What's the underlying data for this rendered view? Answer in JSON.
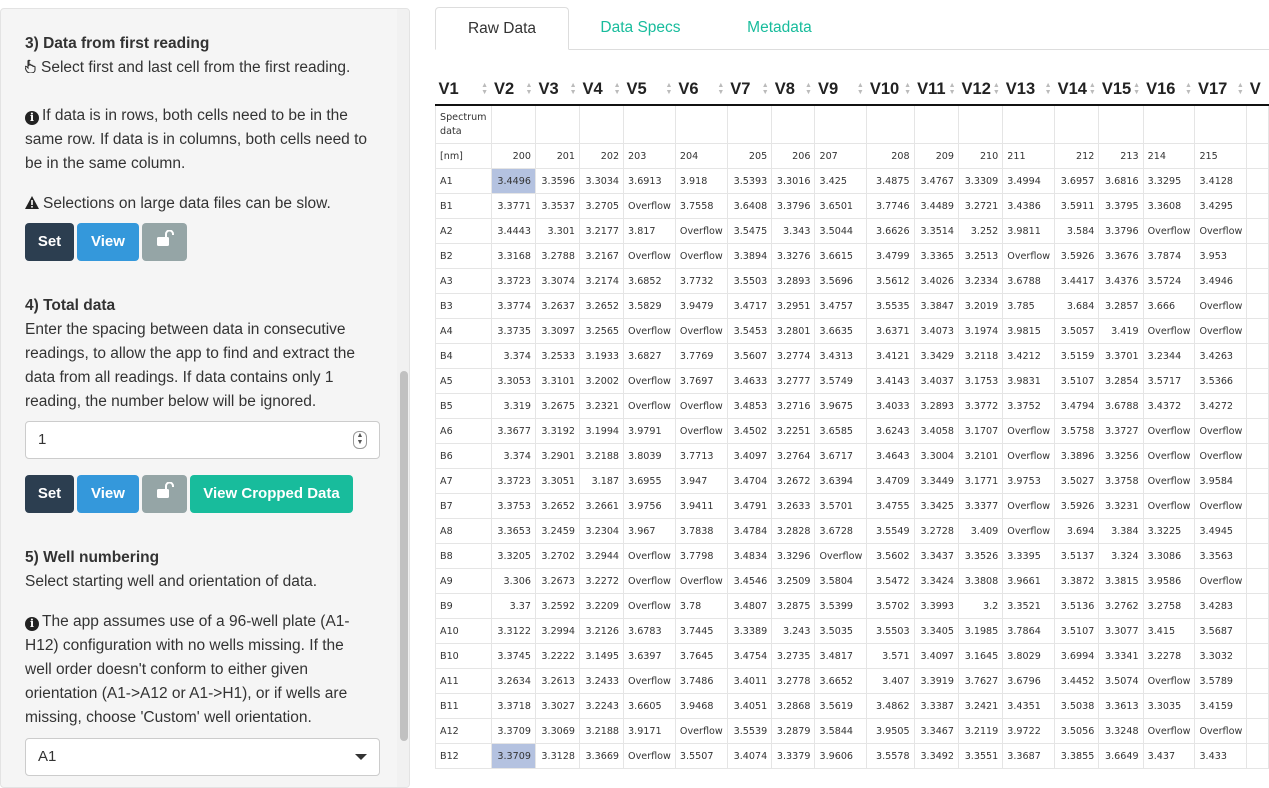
{
  "sidebar": {
    "step3": {
      "heading": "3) Data from first reading",
      "instruction": "Select first and last cell from the first reading.",
      "info": "If data is in rows, both cells need to be in the same row. If data is in columns, both cells need to be in the same column.",
      "warning": "Selections on large data files can be slow.",
      "set_label": "Set",
      "view_label": "View"
    },
    "step4": {
      "heading": "4) Total data",
      "description": "Enter the spacing between data in consecutive readings, to allow the app to find and extract the data from all readings. If data contains only 1 reading, the number below will be ignored.",
      "spacing_value": "1",
      "set_label": "Set",
      "view_label": "View",
      "view_cropped_label": "View Cropped Data"
    },
    "step5": {
      "heading": "5) Well numbering",
      "description": "Select starting well and orientation of data.",
      "info": "The app assumes use of a 96-well plate (A1-H12) configuration with no wells missing. If the well order doesn't conform to either given orientation (A1->A12 or A1->H1), or if wells are missing, choose 'Custom' well orientation.",
      "start_well": "A1"
    }
  },
  "tabs": [
    {
      "label": "Raw Data",
      "active": true
    },
    {
      "label": "Data Specs",
      "active": false
    },
    {
      "label": "Metadata",
      "active": false
    }
  ],
  "colors": {
    "accent": "#18bc9c",
    "primary_dark": "#2c3e50",
    "info_blue": "#3498db",
    "selected_cell": "#b4c2e0"
  },
  "table": {
    "columns": [
      "V1",
      "V2",
      "V3",
      "V4",
      "V5",
      "V6",
      "V7",
      "V8",
      "V9",
      "V10",
      "V11",
      "V12",
      "V13",
      "V14",
      "V15",
      "V16",
      "V17"
    ],
    "spec_row": "Spectrum data",
    "nm_row": [
      "[nm]",
      "200",
      "201",
      "202",
      "203",
      "204",
      "205",
      "206",
      "207",
      "208",
      "209",
      "210",
      "211",
      "212",
      "213",
      "214",
      "215"
    ],
    "rows": [
      [
        "A1",
        "3.4496",
        "3.3596",
        "3.3034",
        "3.6913",
        "3.918",
        "3.5393",
        "3.3016",
        "3.425",
        "3.4875",
        "3.4767",
        "3.3309",
        "3.4994",
        "3.6957",
        "3.6816",
        "3.3295",
        "3.4128"
      ],
      [
        "B1",
        "3.3771",
        "3.3537",
        "3.2705",
        "Overflow",
        "3.7558",
        "3.6408",
        "3.3796",
        "3.6501",
        "3.7746",
        "3.4489",
        "3.2721",
        "3.4386",
        "3.5911",
        "3.3795",
        "3.3608",
        "3.4295"
      ],
      [
        "A2",
        "3.4443",
        "3.301",
        "3.2177",
        "3.817",
        "Overflow",
        "3.5475",
        "3.343",
        "3.5044",
        "3.6626",
        "3.3514",
        "3.252",
        "3.9811",
        "3.584",
        "3.3796",
        "Overflow",
        "Overflow"
      ],
      [
        "B2",
        "3.3168",
        "3.2788",
        "3.2167",
        "Overflow",
        "Overflow",
        "3.3894",
        "3.3276",
        "3.6615",
        "3.4799",
        "3.3365",
        "3.2513",
        "Overflow",
        "3.5926",
        "3.3676",
        "3.7874",
        "3.953"
      ],
      [
        "A3",
        "3.3723",
        "3.3074",
        "3.2174",
        "3.6852",
        "3.7732",
        "3.5503",
        "3.2893",
        "3.5696",
        "3.5612",
        "3.4026",
        "3.2334",
        "3.6788",
        "3.4417",
        "3.4376",
        "3.5724",
        "3.4946"
      ],
      [
        "B3",
        "3.3774",
        "3.2637",
        "3.2652",
        "3.5829",
        "3.9479",
        "3.4717",
        "3.2951",
        "3.4757",
        "3.5535",
        "3.3847",
        "3.2019",
        "3.785",
        "3.684",
        "3.2857",
        "3.666",
        "Overflow"
      ],
      [
        "A4",
        "3.3735",
        "3.3097",
        "3.2565",
        "Overflow",
        "Overflow",
        "3.5453",
        "3.2801",
        "3.6635",
        "3.6371",
        "3.4073",
        "3.1974",
        "3.9815",
        "3.5057",
        "3.419",
        "Overflow",
        "Overflow"
      ],
      [
        "B4",
        "3.374",
        "3.2533",
        "3.1933",
        "3.6827",
        "3.7769",
        "3.5607",
        "3.2774",
        "3.4313",
        "3.4121",
        "3.3429",
        "3.2118",
        "3.4212",
        "3.5159",
        "3.3701",
        "3.2344",
        "3.4263"
      ],
      [
        "A5",
        "3.3053",
        "3.3101",
        "3.2002",
        "Overflow",
        "3.7697",
        "3.4633",
        "3.2777",
        "3.5749",
        "3.4143",
        "3.4037",
        "3.1753",
        "3.9831",
        "3.5107",
        "3.2854",
        "3.5717",
        "3.5366"
      ],
      [
        "B5",
        "3.319",
        "3.2675",
        "3.2321",
        "Overflow",
        "Overflow",
        "3.4853",
        "3.2716",
        "3.9675",
        "3.4033",
        "3.2893",
        "3.3772",
        "3.3752",
        "3.4794",
        "3.6788",
        "3.4372",
        "3.4272"
      ],
      [
        "A6",
        "3.3677",
        "3.3192",
        "3.1994",
        "3.9791",
        "Overflow",
        "3.4502",
        "3.2251",
        "3.6585",
        "3.6243",
        "3.4058",
        "3.1707",
        "Overflow",
        "3.5758",
        "3.3727",
        "Overflow",
        "Overflow"
      ],
      [
        "B6",
        "3.374",
        "3.2901",
        "3.2188",
        "3.8039",
        "3.7713",
        "3.4097",
        "3.2764",
        "3.6717",
        "3.4643",
        "3.3004",
        "3.2101",
        "Overflow",
        "3.3896",
        "3.3256",
        "Overflow",
        "Overflow"
      ],
      [
        "A7",
        "3.3723",
        "3.3051",
        "3.187",
        "3.6955",
        "3.947",
        "3.4704",
        "3.2672",
        "3.6394",
        "3.4709",
        "3.3449",
        "3.1771",
        "3.9753",
        "3.5027",
        "3.3758",
        "Overflow",
        "3.9584"
      ],
      [
        "B7",
        "3.3753",
        "3.2652",
        "3.2661",
        "3.9756",
        "3.9411",
        "3.4791",
        "3.2633",
        "3.5701",
        "3.4755",
        "3.3425",
        "3.3377",
        "Overflow",
        "3.5926",
        "3.3231",
        "Overflow",
        "Overflow"
      ],
      [
        "A8",
        "3.3653",
        "3.2459",
        "3.2304",
        "3.967",
        "3.7838",
        "3.4784",
        "3.2828",
        "3.6728",
        "3.5549",
        "3.2728",
        "3.409",
        "Overflow",
        "3.694",
        "3.384",
        "3.3225",
        "3.4945"
      ],
      [
        "B8",
        "3.3205",
        "3.2702",
        "3.2944",
        "Overflow",
        "3.7798",
        "3.4834",
        "3.3296",
        "Overflow",
        "3.5602",
        "3.3437",
        "3.3526",
        "3.3395",
        "3.5137",
        "3.324",
        "3.3086",
        "3.3563"
      ],
      [
        "A9",
        "3.306",
        "3.2673",
        "3.2272",
        "Overflow",
        "Overflow",
        "3.4546",
        "3.2509",
        "3.5804",
        "3.5472",
        "3.3424",
        "3.3808",
        "3.9661",
        "3.3872",
        "3.3815",
        "3.9586",
        "Overflow"
      ],
      [
        "B9",
        "3.37",
        "3.2592",
        "3.2209",
        "Overflow",
        "3.78",
        "3.4807",
        "3.2875",
        "3.5399",
        "3.5702",
        "3.3993",
        "3.2",
        "3.3521",
        "3.5136",
        "3.2762",
        "3.2758",
        "3.4283"
      ],
      [
        "A10",
        "3.3122",
        "3.2994",
        "3.2126",
        "3.6783",
        "3.7445",
        "3.3389",
        "3.243",
        "3.5035",
        "3.5503",
        "3.3405",
        "3.1985",
        "3.7864",
        "3.5107",
        "3.3077",
        "3.415",
        "3.5687"
      ],
      [
        "B10",
        "3.3745",
        "3.2222",
        "3.1495",
        "3.6397",
        "3.7645",
        "3.4754",
        "3.2735",
        "3.4817",
        "3.571",
        "3.4097",
        "3.1645",
        "3.8029",
        "3.6994",
        "3.3341",
        "3.2278",
        "3.3032"
      ],
      [
        "A11",
        "3.2634",
        "3.2613",
        "3.2433",
        "Overflow",
        "3.7486",
        "3.4011",
        "3.2778",
        "3.6652",
        "3.407",
        "3.3919",
        "3.7627",
        "3.6796",
        "3.4452",
        "3.5074",
        "Overflow",
        "3.5789"
      ],
      [
        "B11",
        "3.3718",
        "3.3027",
        "3.2243",
        "3.6605",
        "3.9468",
        "3.4051",
        "3.2868",
        "3.5619",
        "3.4862",
        "3.3387",
        "3.2421",
        "3.4351",
        "3.5038",
        "3.3613",
        "3.3035",
        "3.4159"
      ],
      [
        "A12",
        "3.3709",
        "3.3069",
        "3.2188",
        "3.9171",
        "Overflow",
        "3.5539",
        "3.2879",
        "3.5844",
        "3.9505",
        "3.3467",
        "3.2119",
        "3.9722",
        "3.5056",
        "3.3248",
        "Overflow",
        "Overflow"
      ],
      [
        "B12",
        "3.3709",
        "3.3128",
        "3.3669",
        "Overflow",
        "3.5507",
        "3.4074",
        "3.3379",
        "3.9606",
        "3.5578",
        "3.3492",
        "3.3551",
        "3.3687",
        "3.3855",
        "3.6649",
        "3.437",
        "3.433"
      ]
    ],
    "selected_cells": [
      [
        0,
        1
      ],
      [
        23,
        1
      ]
    ]
  }
}
